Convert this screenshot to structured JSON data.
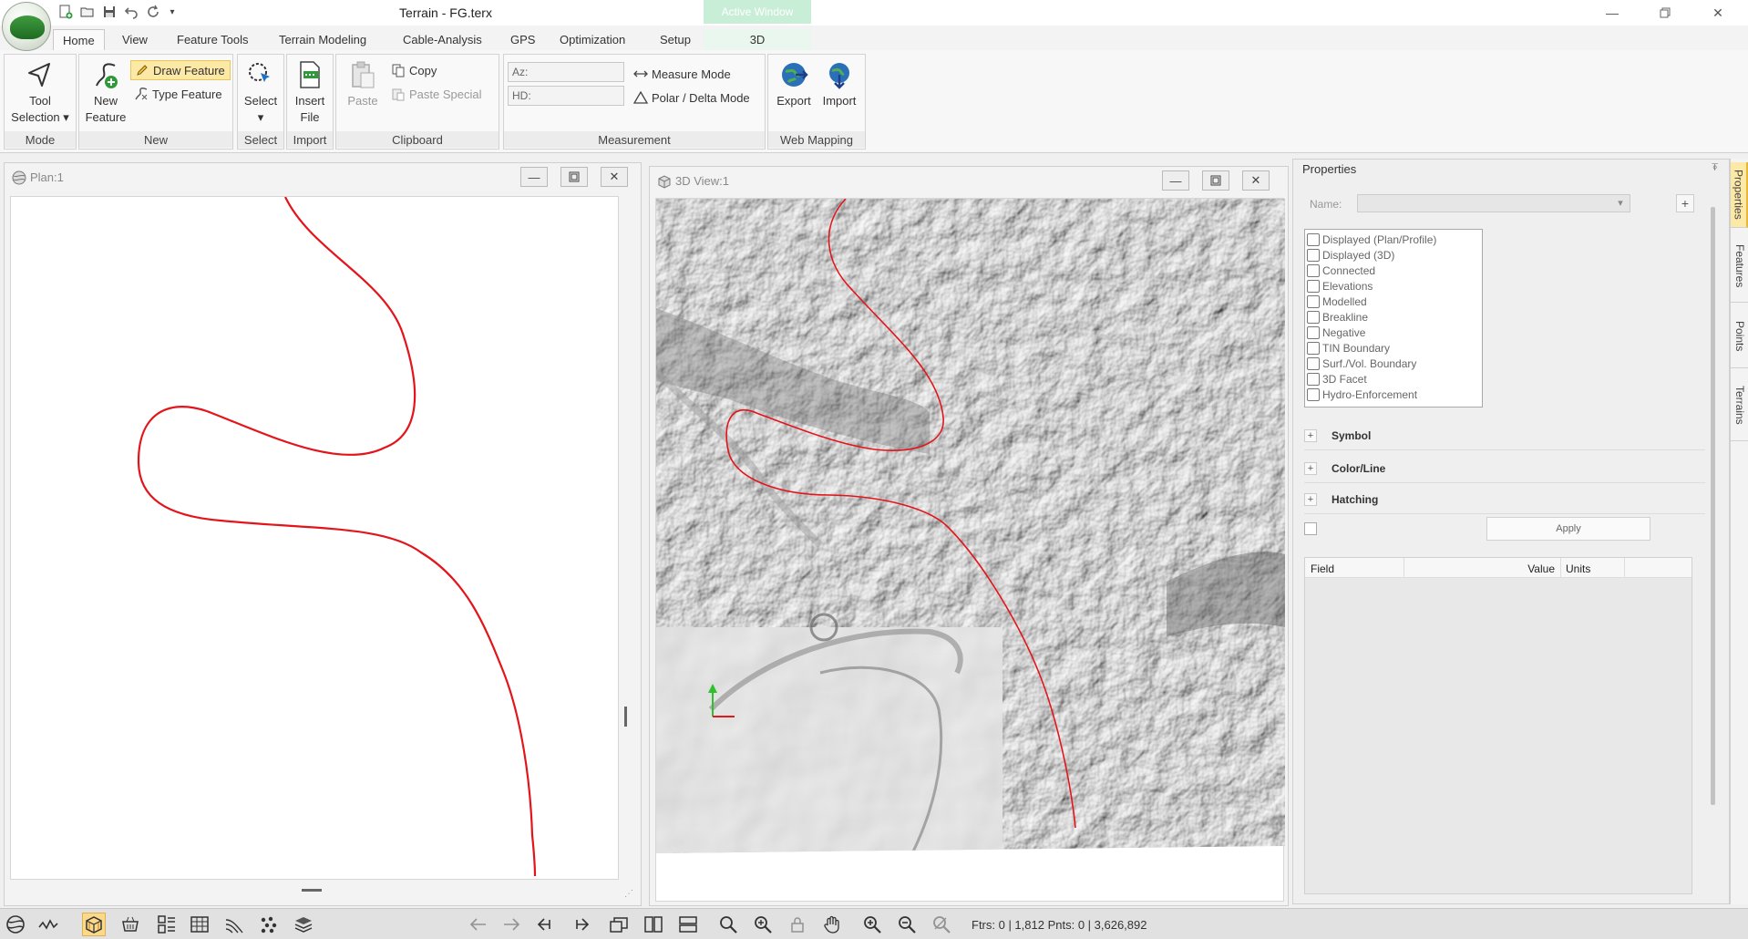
{
  "window": {
    "title": "Terrain - FG.terx",
    "context_tab_header": "Active Window"
  },
  "ribbon_tabs": [
    {
      "label": "Home",
      "active": true
    },
    {
      "label": "View"
    },
    {
      "label": "Feature Tools"
    },
    {
      "label": "Terrain Modeling"
    },
    {
      "label": "Cable-Analysis"
    },
    {
      "label": "GPS"
    },
    {
      "label": "Optimization"
    },
    {
      "label": "Setup"
    },
    {
      "label": "3D"
    }
  ],
  "ribbon": {
    "mode": {
      "tool_selection_line1": "Tool",
      "tool_selection_line2": "Selection",
      "group_label": "Mode"
    },
    "new": {
      "new_feature_line1": "New",
      "new_feature_line2": "Feature",
      "draw_feature": "Draw Feature",
      "type_feature": "Type Feature",
      "group_label": "New"
    },
    "select": {
      "select_label": "Select",
      "group_label": "Select"
    },
    "import": {
      "insert_file_line1": "Insert",
      "insert_file_line2": "File",
      "group_label": "Import"
    },
    "clipboard": {
      "paste": "Paste",
      "copy": "Copy",
      "paste_special": "Paste Special",
      "group_label": "Clipboard"
    },
    "measurement": {
      "az_label": "Az:",
      "hd_label": "HD:",
      "measure_mode": "Measure Mode",
      "polar_delta_mode": "Polar / Delta Mode",
      "group_label": "Measurement"
    },
    "web_mapping": {
      "export": "Export",
      "import": "Import",
      "group_label": "Web Mapping"
    }
  },
  "plan_window": {
    "title": "Plan:1"
  },
  "view3d_window": {
    "title": "3D View:1"
  },
  "properties": {
    "title": "Properties",
    "pin": "⍕",
    "name_label": "Name:",
    "name_value": "",
    "add": "+",
    "flags": [
      "Displayed (Plan/Profile)",
      "Displayed (3D)",
      "Connected",
      "Elevations",
      "Modelled",
      "Breakline",
      "Negative",
      "TIN Boundary",
      "Surf./Vol. Boundary",
      "3D Facet",
      "Hydro-Enforcement"
    ],
    "sections": [
      "Symbol",
      "Color/Line",
      "Hatching"
    ],
    "apply": "Apply",
    "table_headers": {
      "field": "Field",
      "value": "Value",
      "units": "Units"
    }
  },
  "side_tabs": [
    "Properties",
    "Features",
    "Points",
    "Terrains"
  ],
  "status": {
    "text": "Ftrs: 0 | 1,812   Pnts: 0 | 3,626,892"
  },
  "colors": {
    "feature_line": "#e3141a",
    "highlight": "#fde9a6"
  }
}
